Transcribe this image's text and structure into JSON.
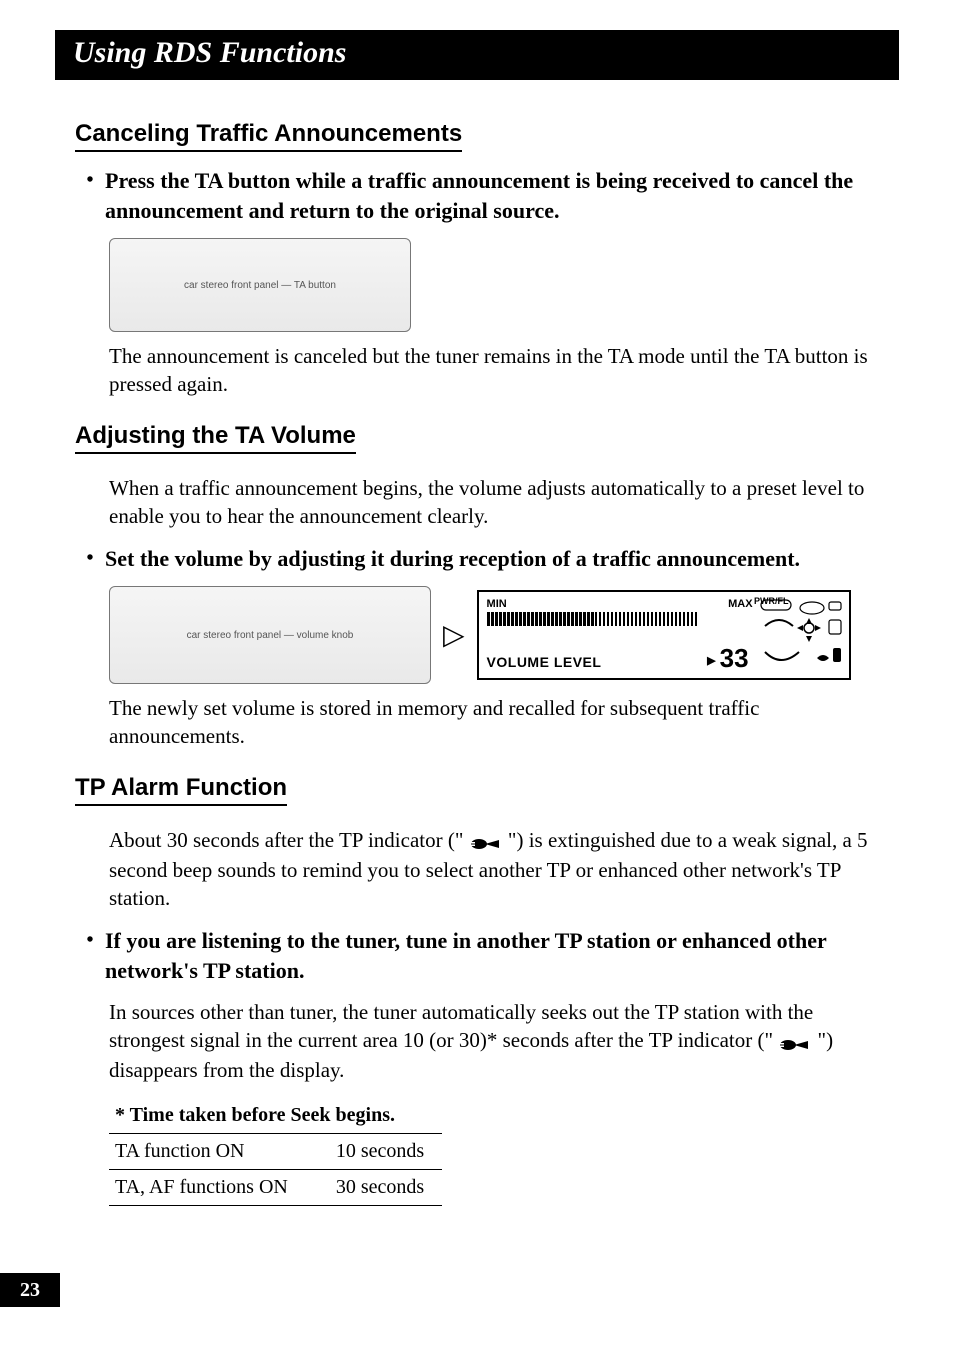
{
  "chapter_title": "Using RDS Functions",
  "page_number": "23",
  "sections": {
    "cancel": {
      "title": "Canceling Traffic Announcements",
      "bullet": "Press the TA button while a traffic announcement is being received to cancel the announcement and return to the original source.",
      "after_fig": "The announcement is canceled but the tuner remains in the TA mode until the TA button is pressed again.",
      "fig_alt": "car stereo front panel — TA button"
    },
    "ta_volume": {
      "title": "Adjusting the TA Volume",
      "intro": "When a traffic announcement begins, the volume adjusts automatically to a preset level to enable you to hear the announcement clearly.",
      "bullet": "Set the volume by adjusting it during reception of a traffic announcement.",
      "after_fig": "The newly set volume is stored in memory and recalled for subsequent traffic announcements.",
      "fig_left_alt": "car stereo front panel — volume knob",
      "display": {
        "min": "MIN",
        "max": "MAX",
        "pwr": "PWR/FL",
        "label": "VOLUME LEVEL",
        "value": "33"
      }
    },
    "tp_alarm": {
      "title": "TP Alarm Function",
      "intro_a": "About 30 seconds after the TP indicator (\" ",
      "intro_b": " \") is extinguished due to a weak signal, a 5 second beep sounds to remind you to select another TP or enhanced other network's TP station.",
      "bullet": "If you are listening to the tuner, tune in another TP station or enhanced other network's TP station.",
      "body2_a": "In sources other than tuner, the tuner automatically seeks out the TP station with the strongest signal in the current area 10 (or 30)* seconds after the TP indicator (\" ",
      "body2_b": " \") disappears from the display.",
      "table_caption": "* Time taken before Seek begins.",
      "table": [
        {
          "label": "TA function ON",
          "value": "10 seconds"
        },
        {
          "label": "TA, AF functions ON",
          "value": "30 seconds"
        }
      ]
    }
  }
}
